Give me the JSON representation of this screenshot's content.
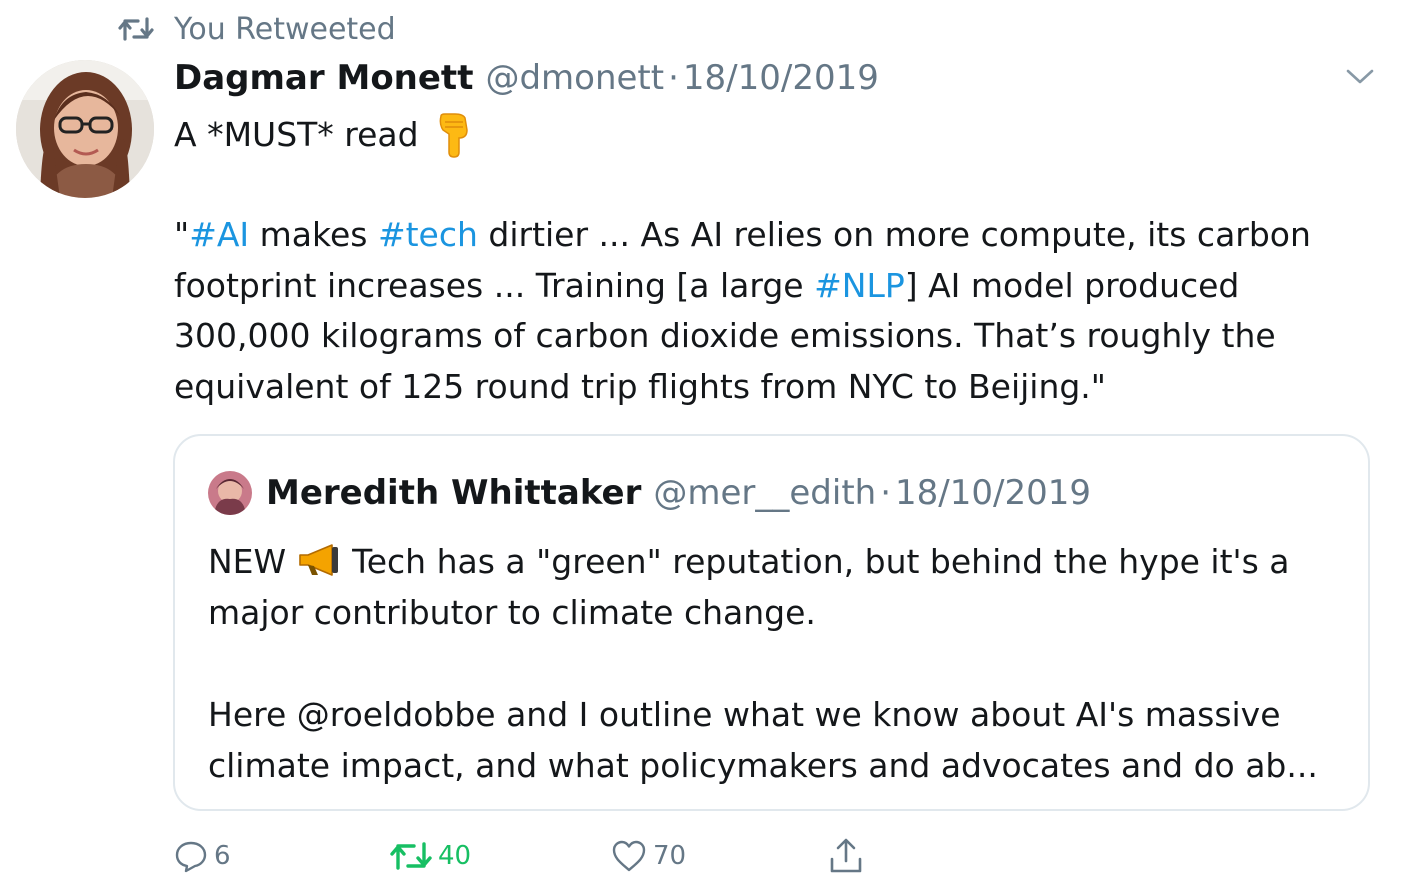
{
  "retweet_banner": {
    "label": "You Retweeted",
    "icon": "retweet-icon"
  },
  "author": {
    "name": "Dagmar Monett",
    "handle": "@dmonett",
    "separator": "·",
    "date": "18/10/2019"
  },
  "tweet": {
    "first_line": "A *MUST* read",
    "first_line_emoji": "backhand-index-pointing-down",
    "lines": [
      [
        {
          "t": "\""
        },
        {
          "t": "#AI",
          "tag": true
        },
        {
          "t": " makes "
        },
        {
          "t": "#tech",
          "tag": true
        },
        {
          "t": " dirtier ... As AI relies on more compute, its carbon"
        }
      ],
      [
        {
          "t": "footprint increases ... Training [a large "
        },
        {
          "t": "#NLP",
          "tag": true
        },
        {
          "t": "] AI model produced"
        }
      ],
      [
        {
          "t": "300,000 kilograms of carbon dioxide emissions. That’s roughly the"
        }
      ],
      [
        {
          "t": "equivalent of 125 round trip flights from NYC to Beijing.\""
        }
      ]
    ]
  },
  "quoted_tweet": {
    "name": "Meredith Whittaker",
    "handle": "@mer__edith",
    "separator": "·",
    "date": "18/10/2019",
    "line1_prefix": "NEW",
    "line1_emoji": "megaphone",
    "line1_rest": "Tech has a \"green\" reputation, but behind the hype it's a",
    "line2": "major contributor to climate change.",
    "line3": "Here @roeldobbe and I outline what we know about AI's massive",
    "line4": "climate impact, and what policymakers and advocates and do ab..."
  },
  "actions": {
    "replies": "6",
    "retweets": "40",
    "likes": "70"
  },
  "colors": {
    "hashtag": "#1b95e0",
    "retweeted": "#17bf63",
    "secondary_text": "#657786",
    "border": "#e1e8ed"
  }
}
